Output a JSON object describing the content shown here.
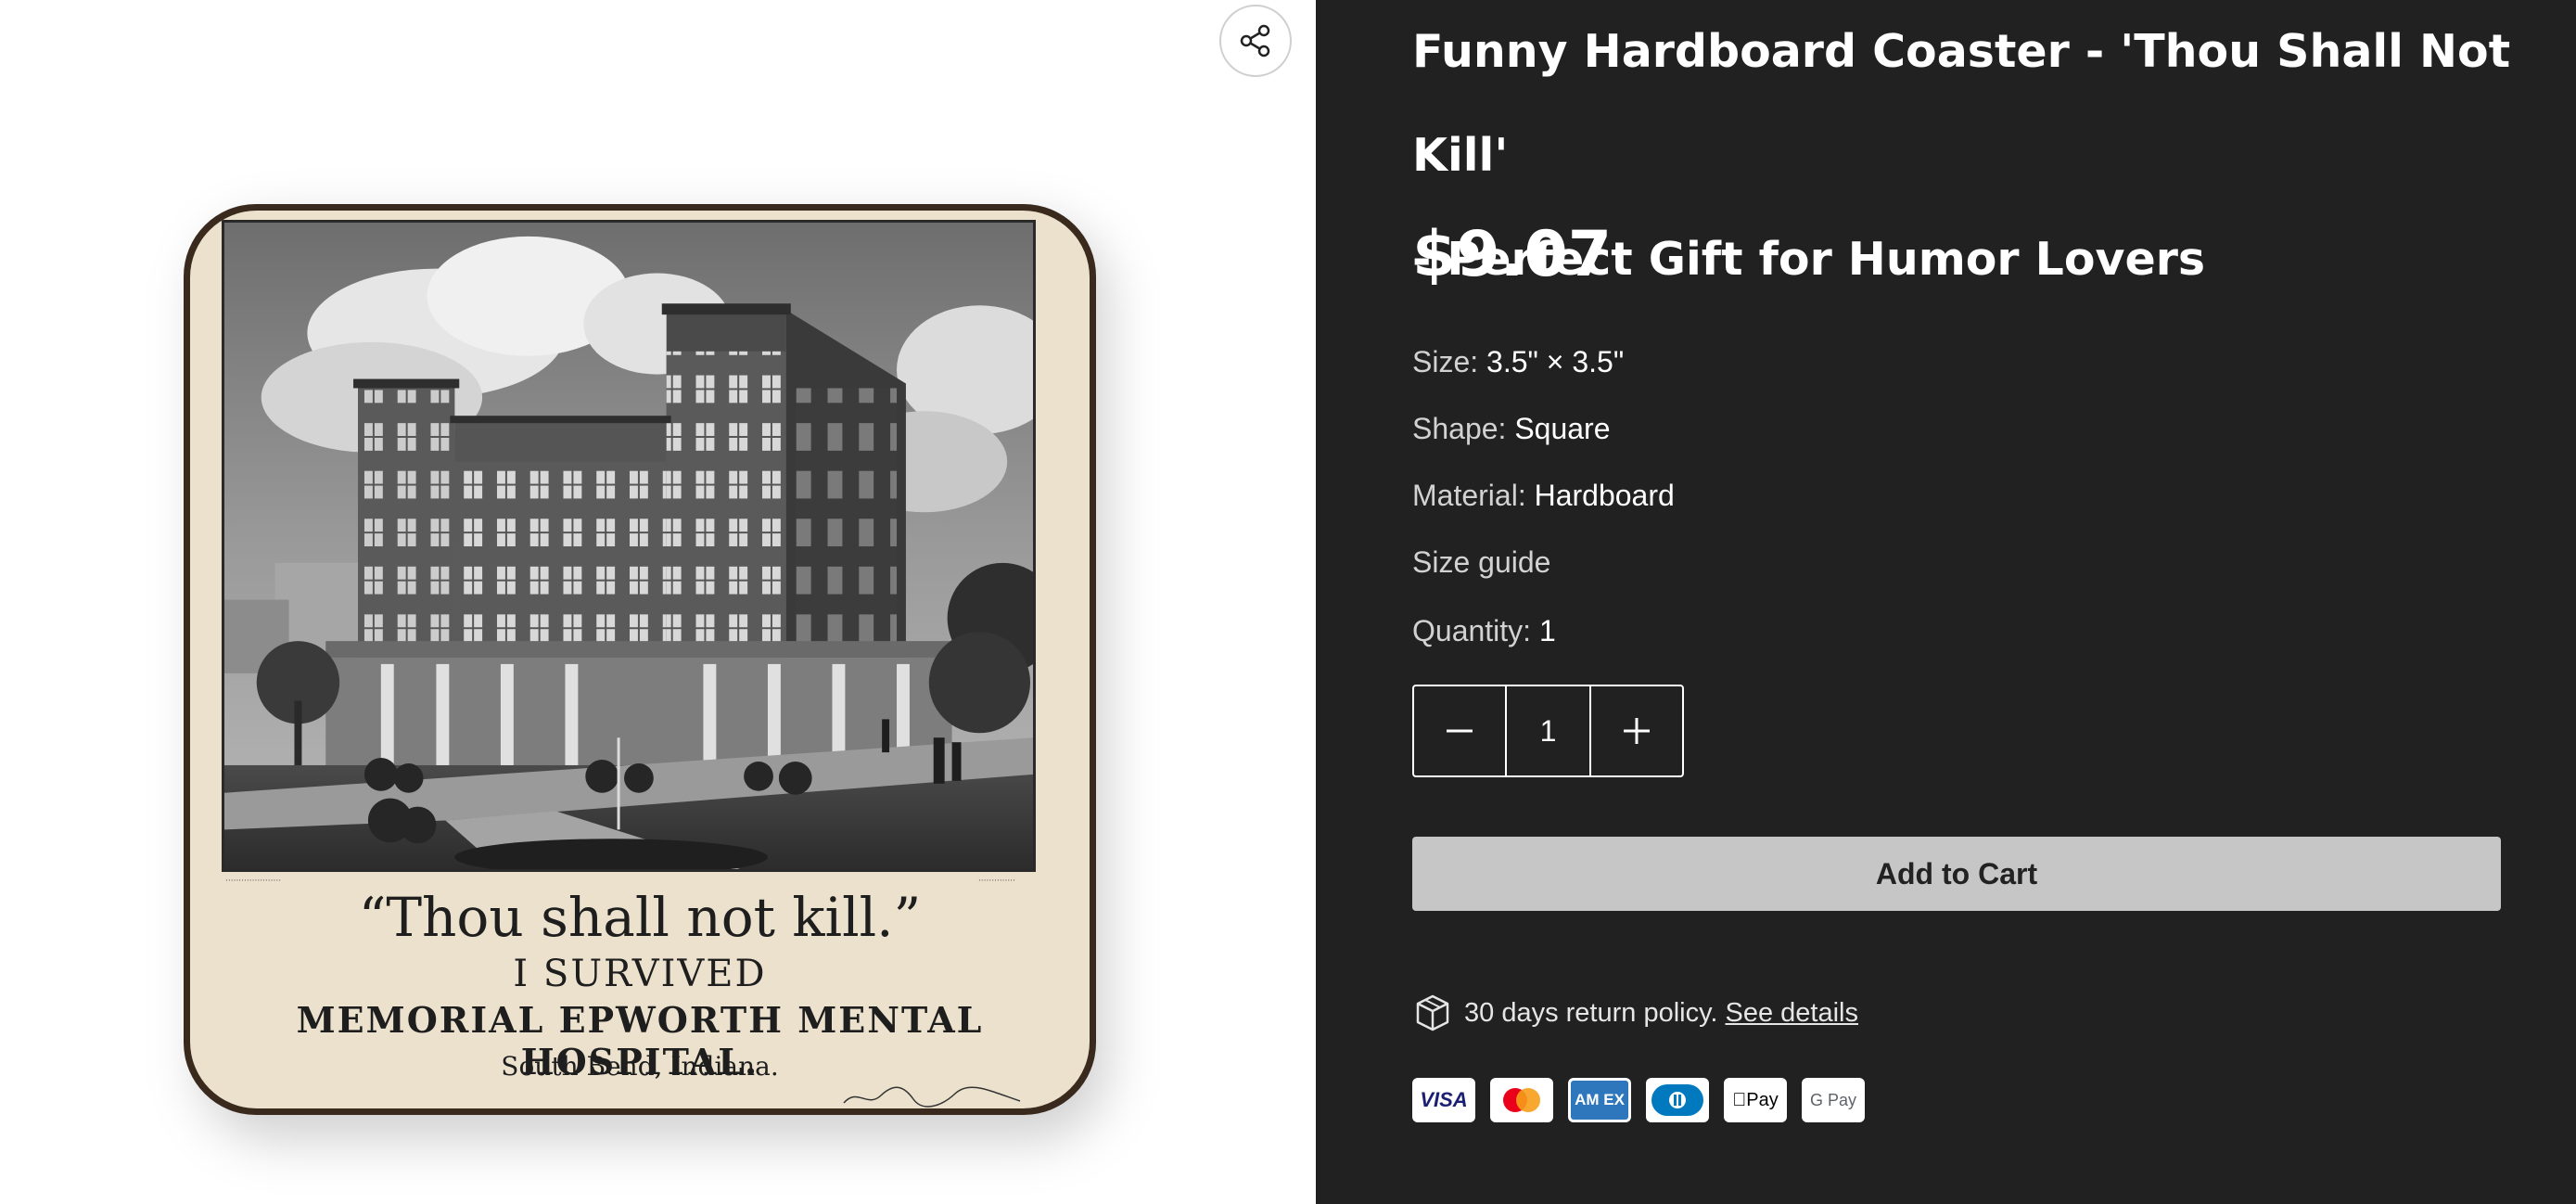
{
  "product": {
    "title_line1": "Funny Hardboard Coaster - 'Thou Shall Not Kill'",
    "title_line2": "- Perfect Gift for Humor Lovers",
    "price": "$9.07"
  },
  "specs": {
    "size_label": "Size:",
    "size_value": "3.5\" × 3.5\"",
    "shape_label": "Shape:",
    "shape_value": "Square",
    "material_label": "Material:",
    "material_value": "Hardboard",
    "size_guide": "Size guide",
    "quantity_label": "Quantity:",
    "quantity_value": "1"
  },
  "stepper": {
    "value": "1",
    "decrement_icon": "minus-icon",
    "increment_icon": "plus-icon"
  },
  "actions": {
    "add_to_cart": "Add to Cart",
    "share_icon": "share-icon"
  },
  "returns": {
    "icon": "package-icon",
    "text": "30 days return policy.",
    "link": "See details"
  },
  "payments": [
    {
      "name": "Visa",
      "label": "VISA"
    },
    {
      "name": "Mastercard",
      "label": ""
    },
    {
      "name": "American Express",
      "label": "AM EX"
    },
    {
      "name": "Diners Club",
      "label": ""
    },
    {
      "name": "Apple Pay",
      "label": "Pay"
    },
    {
      "name": "Google Pay",
      "label": "G Pay"
    }
  ],
  "coaster_art": {
    "quote": "“Thou shall not kill.”",
    "line2": "I SURVIVED",
    "line3": "MEMORIAL EPWORTH MENTAL HOSPITAL.",
    "line4": "South Bend, Indiana."
  },
  "colors": {
    "right_panel_bg": "#212121",
    "button_bg": "#c6c6c6",
    "coaster_cream": "#ebe1cd",
    "coaster_edge": "#3a2a1e"
  }
}
